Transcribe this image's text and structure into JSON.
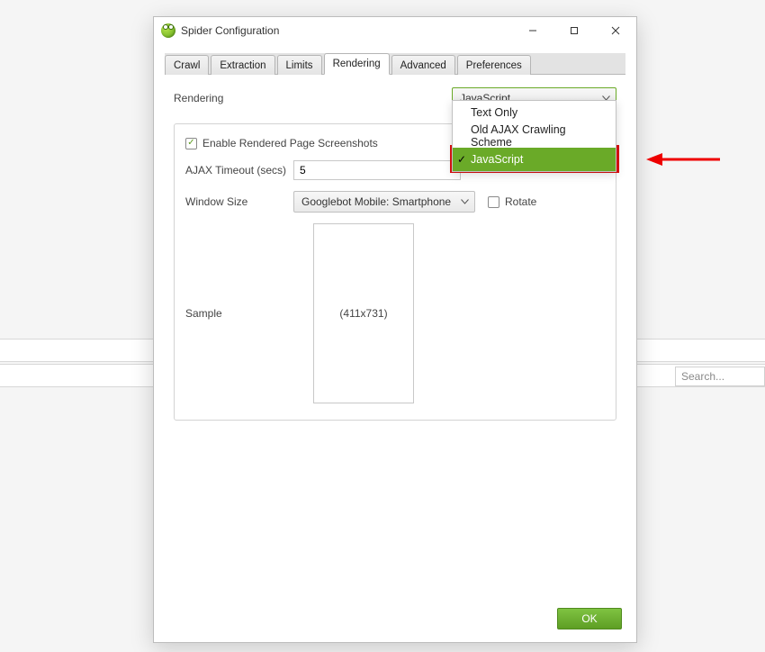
{
  "window": {
    "title": "Spider Configuration"
  },
  "tabs": [
    {
      "label": "Crawl",
      "active": false
    },
    {
      "label": "Extraction",
      "active": false
    },
    {
      "label": "Limits",
      "active": false
    },
    {
      "label": "Rendering",
      "active": true
    },
    {
      "label": "Advanced",
      "active": false
    },
    {
      "label": "Preferences",
      "active": false
    }
  ],
  "rendering": {
    "label": "Rendering",
    "selected": "JavaScript",
    "options": [
      "Text Only",
      "Old AJAX Crawling Scheme",
      "JavaScript"
    ],
    "selected_index": 2
  },
  "group": {
    "enable_screenshots": {
      "label": "Enable Rendered Page Screenshots",
      "checked": true
    },
    "ajax_timeout": {
      "label": "AJAX Timeout (secs)",
      "value": "5"
    },
    "window_size": {
      "label": "Window Size",
      "selected": "Googlebot Mobile: Smartphone"
    },
    "rotate": {
      "label": "Rotate",
      "checked": false
    },
    "sample": {
      "label": "Sample",
      "dims": "(411x731)"
    }
  },
  "buttons": {
    "ok": "OK"
  },
  "background": {
    "search_placeholder": "Search..."
  }
}
